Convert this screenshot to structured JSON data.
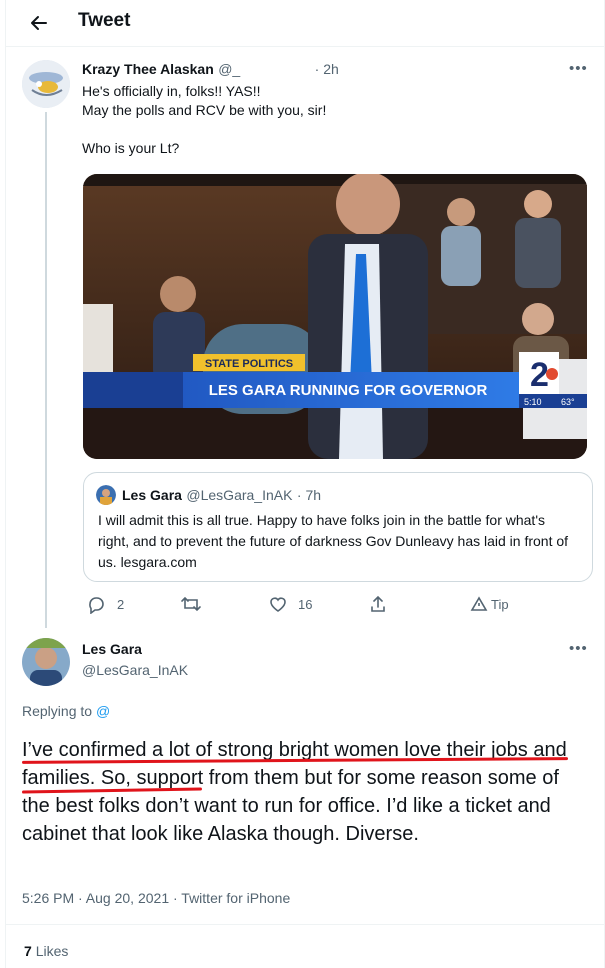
{
  "header": {
    "title": "Tweet",
    "back_icon": "arrow-left-icon"
  },
  "tweet1": {
    "display_name": "Krazy Thee Alaskan",
    "handle": "@_",
    "time": "· 2h",
    "line1": "He's officially in, folks!! YAS!!",
    "line2": "May the polls and RCV be with you, sir!",
    "line3": "Who is your Lt?",
    "media": {
      "banner_tag": "STATE POLITICS",
      "banner_headline": "LES GARA RUNNING FOR GOVERNOR",
      "station": "2",
      "time_text": "5:10",
      "temp_text": "63°"
    },
    "quote": {
      "display_name": "Les Gara",
      "handle": "@LesGara_InAK",
      "time": "· 7h",
      "text": "I will admit this is all true. Happy to have folks join in the battle for what's right, and to prevent the future of darkness Gov Dunleavy has laid in front of us. lesgara.com"
    },
    "actions": {
      "replies": "2",
      "likes": "16",
      "tip": "Tip"
    }
  },
  "tweet2": {
    "display_name": "Les Gara",
    "handle": "@LesGara_InAK",
    "replying_prefix": "Replying to",
    "replying_handle": "@",
    "text": "I’ve confirmed a lot of strong bright women love their jobs and families. So, support from them but for some reason some of the best folks don’t want to run for office. I’d like a ticket and cabinet that look like Alaska though. Diverse.",
    "meta": "5:26 PM · Aug 20, 2021 · Twitter for iPhone",
    "likes_count": "7",
    "likes_label": "Likes"
  },
  "colors": {
    "accent": "#1d9bf0",
    "underline": "#e0141b",
    "muted": "#536471",
    "border": "#cfd9de"
  }
}
